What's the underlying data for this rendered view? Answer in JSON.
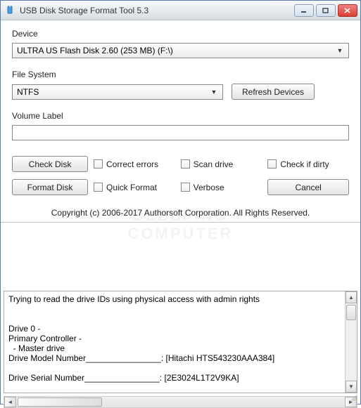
{
  "window": {
    "title": "USB Disk Storage Format Tool 5.3"
  },
  "labels": {
    "device": "Device",
    "file_system": "File System",
    "volume_label": "Volume Label"
  },
  "device": {
    "selected": "ULTRA US  Flash Disk  2.60 (253 MB) (F:\\)"
  },
  "file_system": {
    "selected": "NTFS"
  },
  "volume_label_value": "",
  "buttons": {
    "refresh": "Refresh Devices",
    "check_disk": "Check Disk",
    "format_disk": "Format Disk",
    "cancel": "Cancel"
  },
  "checkboxes": {
    "correct_errors": "Correct errors",
    "scan_drive": "Scan drive",
    "check_if_dirty": "Check if dirty",
    "quick_format": "Quick Format",
    "verbose": "Verbose"
  },
  "copyright": "Copyright (c) 2006-2017 Authorsoft Corporation. All Rights Reserved.",
  "log": "Trying to read the drive IDs using physical access with admin rights\n\n\nDrive 0 -\nPrimary Controller -\n  - Master drive\nDrive Model Number________________: [Hitachi HTS543230AAA384]\n\nDrive Serial Number________________: [2E3024L1T2V9KA]"
}
